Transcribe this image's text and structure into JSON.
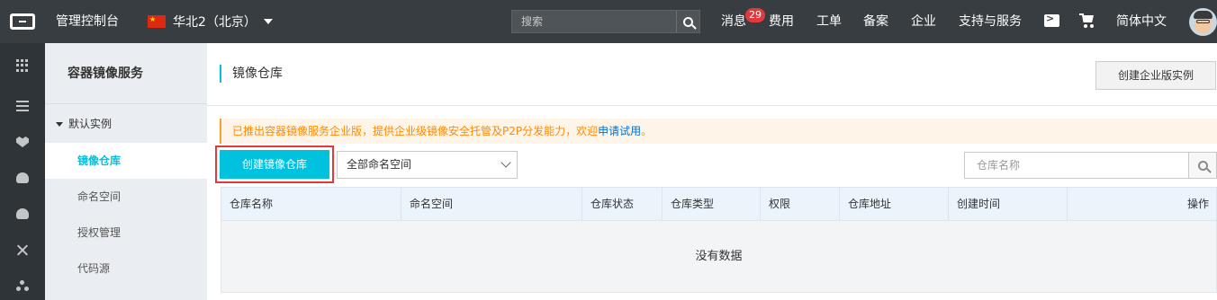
{
  "topbar": {
    "console_label": "管理控制台",
    "region_label": "华北2（北京）",
    "search_placeholder": "搜索",
    "nav": {
      "messages": "消息",
      "messages_count": "29",
      "billing": "费用",
      "tickets": "工单",
      "icp": "备案",
      "enterprise": "企业",
      "support": "支持与服务",
      "language": "简体中文"
    }
  },
  "rail_icons": [
    "grid-icon",
    "list-icon",
    "heart-icon",
    "cloud-icon",
    "cloud-upload-icon",
    "cross-icon",
    "network-icon"
  ],
  "sidebar": {
    "title": "容器镜像服务",
    "group": "默认实例",
    "items": [
      {
        "label": "镜像仓库",
        "active": true
      },
      {
        "label": "命名空间",
        "active": false
      },
      {
        "label": "授权管理",
        "active": false
      },
      {
        "label": "代码源",
        "active": false
      }
    ]
  },
  "main": {
    "title": "镜像仓库",
    "enterprise_button": "创建企业版实例",
    "notice": {
      "text": "已推出容器镜像服务企业版，提供企业级镜像安全托管及P2P分发能力，欢迎",
      "link": "申请试用",
      "suffix": "。"
    },
    "create_button": "创建镜像仓库",
    "namespace_select": "全部命名空间",
    "search_placeholder": "仓库名称",
    "table": {
      "columns": [
        "仓库名称",
        "命名空间",
        "仓库状态",
        "仓库类型",
        "权限",
        "仓库地址",
        "创建时间",
        "操作"
      ],
      "empty_text": "没有数据"
    }
  },
  "colors": {
    "topbar": "#373d41",
    "accent": "#00c1de",
    "highlight": "#e4393c",
    "notice_text": "#ff8a00"
  }
}
